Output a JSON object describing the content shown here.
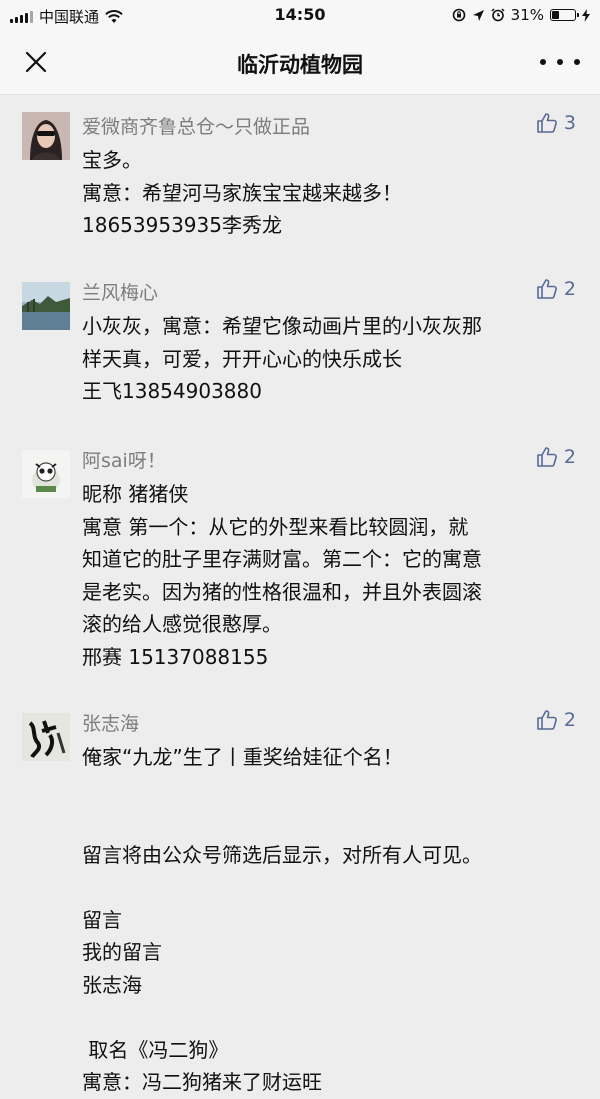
{
  "status_bar": {
    "carrier": "中国联通",
    "time": "14:50",
    "battery": "31%",
    "battery_level": 0.31
  },
  "nav": {
    "title": "临沂动植物园"
  },
  "comments": [
    {
      "nickname": "爱微商齐鲁总仓～只做正品",
      "likes": "3",
      "lines": [
        "宝多。",
        "寓意：希望河马家族宝宝越来越多！",
        "18653953935李秀龙"
      ]
    },
    {
      "nickname": "兰风梅心",
      "likes": "2",
      "lines": [
        "小灰灰，寓意：希望它像动画片里的小灰灰那",
        "样天真，可爱，开开心心的快乐成长",
        "王飞13854903880"
      ]
    },
    {
      "nickname": "阿sai呀！",
      "likes": "2",
      "lines": [
        "昵称  猪猪侠",
        "寓意  第一个：从它的外型来看比较圆润，就",
        "知道它的肚子里存满财富。第二个：它的寓意",
        "是老实。因为猪的性格很温和，并且外表圆滚",
        "滚的给人感觉很憨厚。",
        "邢赛 15137088155"
      ]
    },
    {
      "nickname": "张志海",
      "likes": "2",
      "lines": [
        "俺家“九龙”生了丨重奖给娃征个名！",
        "",
        "",
        "留言将由公众号筛选后显示，对所有人可见。",
        "",
        "留言",
        "我的留言",
        "张志海",
        "",
        " 取名《冯二狗》",
        "寓意：冯二狗猪来了财运旺"
      ]
    }
  ]
}
